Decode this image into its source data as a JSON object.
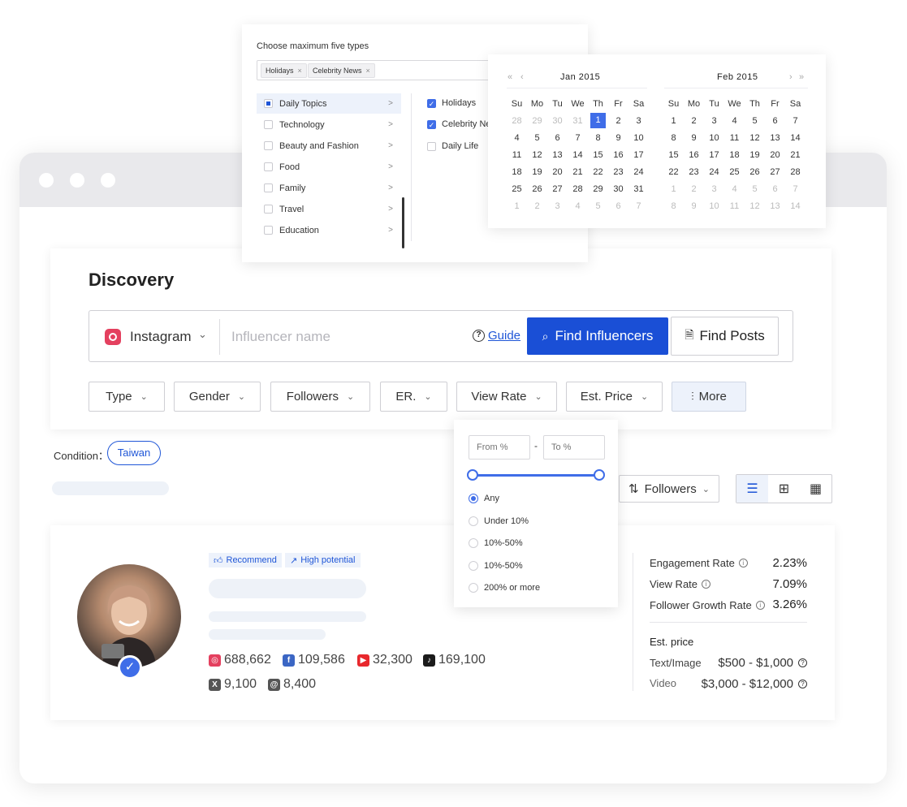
{
  "discovery": {
    "title": "Discovery",
    "platform": "Instagram",
    "search_placeholder": "Influencer name",
    "guide_label": "Guide",
    "find_influencers_label": "Find Influencers",
    "find_posts_label": "Find Posts",
    "filters": [
      "Type",
      "Gender",
      "Followers",
      "ER.",
      "View Rate",
      "Est. Price",
      "More"
    ]
  },
  "condition": {
    "label": "Condition：",
    "chip": "Taiwan"
  },
  "sort": {
    "label": "Followers"
  },
  "type_panel": {
    "title": "Choose maximum five types",
    "selected_chips": [
      "Holidays",
      "Celebrity News"
    ],
    "categories": [
      "Daily Topics",
      "Technology",
      "Beauty and Fashion",
      "Food",
      "Family",
      "Travel",
      "Education"
    ],
    "subcategories": [
      {
        "label": "Holidays",
        "checked": true
      },
      {
        "label": "Celebrity News",
        "checked": true
      },
      {
        "label": "Daily Life",
        "checked": false
      }
    ]
  },
  "calendar": {
    "weekdays": [
      "Su",
      "Mo",
      "Tu",
      "We",
      "Th",
      "Fr",
      "Sa"
    ],
    "months": [
      {
        "title": "Jan  2015",
        "days": [
          "28",
          "29",
          "30",
          "31",
          "1",
          "2",
          "3",
          "4",
          "5",
          "6",
          "7",
          "8",
          "9",
          "10",
          "11",
          "12",
          "13",
          "14",
          "15",
          "16",
          "17",
          "18",
          "19",
          "20",
          "21",
          "22",
          "23",
          "24",
          "25",
          "26",
          "27",
          "28",
          "29",
          "30",
          "31",
          "1",
          "2",
          "3",
          "4",
          "5",
          "6",
          "7"
        ],
        "first_current": 4,
        "last_current": 34,
        "selected": 4
      },
      {
        "title": "Feb  2015",
        "days": [
          "1",
          "2",
          "3",
          "4",
          "5",
          "6",
          "7",
          "8",
          "9",
          "10",
          "11",
          "12",
          "13",
          "14",
          "15",
          "16",
          "17",
          "18",
          "19",
          "20",
          "21",
          "22",
          "23",
          "24",
          "25",
          "26",
          "27",
          "28",
          "1",
          "2",
          "3",
          "4",
          "5",
          "6",
          "7",
          "8",
          "9",
          "10",
          "11",
          "12",
          "13",
          "14"
        ],
        "first_current": 0,
        "last_current": 27,
        "selected": -1
      }
    ]
  },
  "view_rate": {
    "from_placeholder": "From %",
    "to_placeholder": "To %",
    "dash": "-",
    "options": [
      "Any",
      "Under 10%",
      "10%-50%",
      "10%-50%",
      "200% or more"
    ],
    "selected_index": 0
  },
  "influencer": {
    "tags": [
      "Recommend",
      "High potential"
    ],
    "stats": {
      "instagram": "688,662",
      "facebook": "109,586",
      "youtube": "32,300",
      "tiktok": "169,100",
      "x": "9,100",
      "threads": "8,400"
    },
    "metrics": [
      {
        "label": "Engagement Rate",
        "value": "2.23%"
      },
      {
        "label": "View Rate",
        "value": "7.09%"
      },
      {
        "label": "Follower Growth Rate",
        "value": "3.26%"
      }
    ],
    "est_price_title": "Est. price",
    "prices": [
      {
        "label": "Text/Image",
        "value": "$500 - $1,000"
      },
      {
        "label": "Video",
        "value": "$3,000 - $12,000"
      }
    ]
  },
  "colors": {
    "accent": "#1a4fd6",
    "instagram": "#e4405f",
    "facebook": "#3b66c4",
    "youtube": "#e8282d"
  }
}
